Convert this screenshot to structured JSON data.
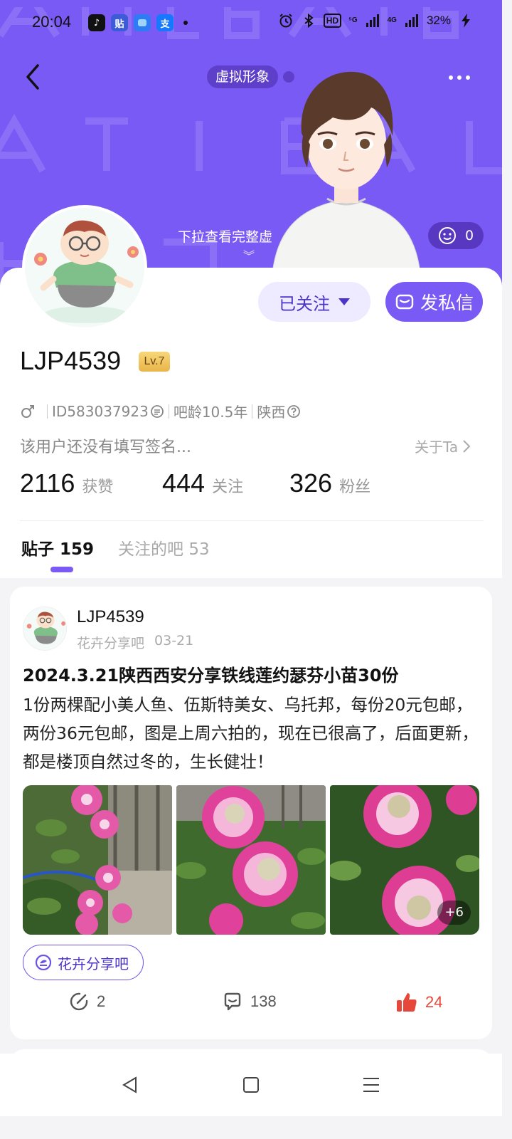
{
  "status_bar": {
    "time": "20:04",
    "apps": [
      "tiktok-icon",
      "tieba-icon",
      "message-app-icon",
      "alipay-icon"
    ],
    "app_labels": [
      "♪",
      "贴",
      "",
      "支"
    ],
    "network_5g": "⁵G",
    "network_4g": "4G",
    "hd": "HD",
    "battery": "32%"
  },
  "header": {
    "virtual_avatar_chip": "虚拟形象",
    "pull_hint": "下拉查看完整虚",
    "pull_arrow": "︾",
    "mood_count": "0"
  },
  "profile": {
    "username": "LJP4539",
    "level": "Lv.7",
    "id": "ID583037923",
    "tieba_age": "吧龄10.5年",
    "region": "陕西",
    "signature": "该用户还没有填写签名...",
    "about": "关于Ta",
    "follow_button": "已关注",
    "message_button": "发私信",
    "stats": [
      {
        "num": "2116",
        "label": "获赞"
      },
      {
        "num": "444",
        "label": "关注"
      },
      {
        "num": "326",
        "label": "粉丝"
      }
    ]
  },
  "tabs": [
    {
      "label": "贴子 159"
    },
    {
      "label": "关注的吧 53"
    }
  ],
  "post": {
    "author": "LJP4539",
    "forum": "花卉分享吧",
    "date": "03-21",
    "title": "2024.3.21陕西西安分享铁线莲约瑟芬小苗30份",
    "body": "1份两棵配小美人鱼、伍斯特美女、乌托邦，每份20元包邮，两份36元包邮，图是上周六拍的，现在已很高了，后面更新，都是楼顶自然过冬的，生长健壮！",
    "more_photos": "+6",
    "forum_tag": "花卉分享吧",
    "shares": "2",
    "comments": "138",
    "likes": "24"
  },
  "colors": {
    "brand_purple": "#7a5af5",
    "follow_text": "#4b34c8",
    "like_red": "#e5483b",
    "level_gold": "#e9b548"
  }
}
